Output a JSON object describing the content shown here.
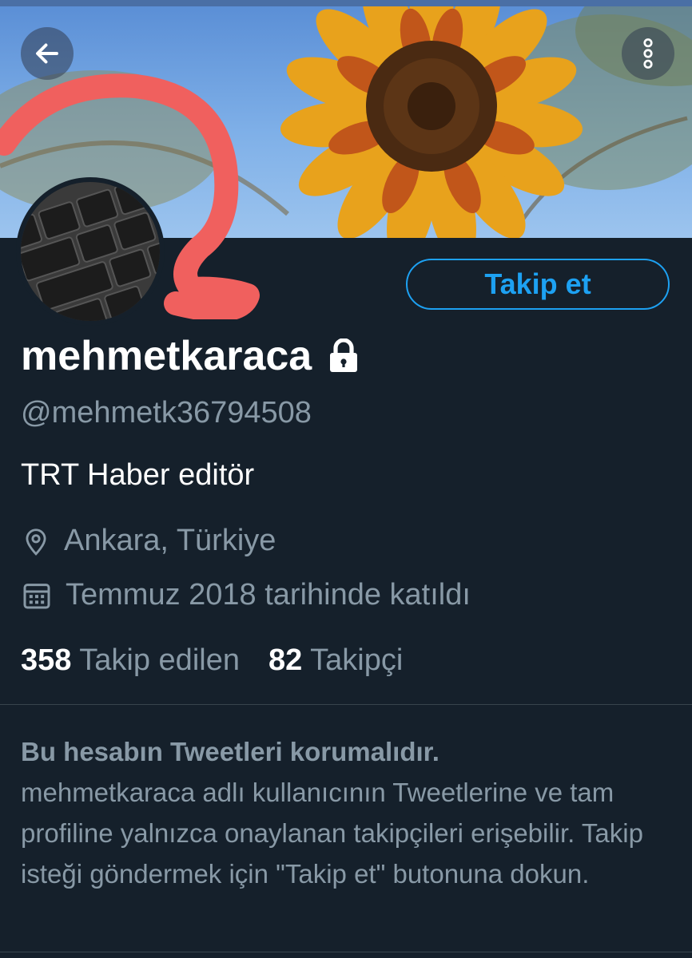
{
  "header": {
    "back_icon": "arrow-left-icon",
    "more_icon": "more-vertical-icon"
  },
  "profile": {
    "display_name": "mehmetkaraca",
    "lock_icon": "lock-icon",
    "handle": "@mehmetk36794508",
    "bio": "TRT Haber editör",
    "location_icon": "map-pin-icon",
    "location": "Ankara, Türkiye",
    "joined_icon": "calendar-icon",
    "joined": "Temmuz 2018 tarihinde katıldı"
  },
  "follow_button": {
    "label": "Takip et"
  },
  "stats": {
    "following_count": "358",
    "following_label": "Takip edilen",
    "followers_count": "82",
    "followers_label": "Takipçi"
  },
  "protected_notice": {
    "title": "Bu hesabın Tweetleri korumalıdır.",
    "body": "mehmetkaraca adlı kullanıcının Tweetlerine ve tam profiline yalnızca onaylanan takipçileri erişebilir. Takip isteği göndermek için \"Takip et\" butonuna dokun."
  },
  "colors": {
    "background": "#15202b",
    "accent": "#1da1f2",
    "secondary_text": "#8899a6"
  }
}
